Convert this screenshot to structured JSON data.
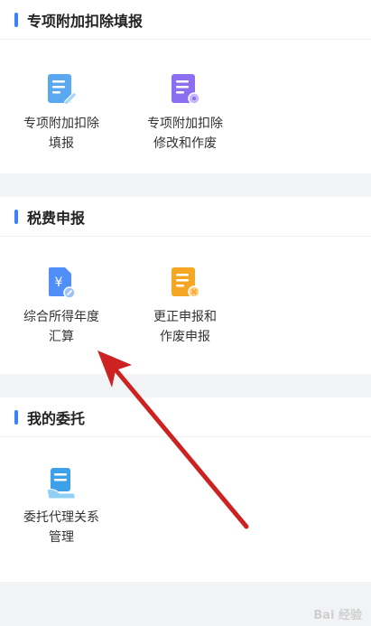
{
  "sections": [
    {
      "title": "专项附加扣除填报",
      "items": [
        {
          "line1": "专项附加扣除",
          "line2": "填报",
          "icon": "document-edit-icon",
          "color": "#5aa9f0"
        },
        {
          "line1": "专项附加扣除",
          "line2": "修改和作废",
          "icon": "document-settings-icon",
          "color": "#8b6ff0"
        }
      ]
    },
    {
      "title": "税费申报",
      "items": [
        {
          "line1": "综合所得年度",
          "line2": "汇算",
          "icon": "yuan-document-icon",
          "color": "#4f8ff7"
        },
        {
          "line1": "更正申报和",
          "line2": "作废申报",
          "icon": "document-cancel-icon",
          "color": "#f5a623"
        }
      ]
    },
    {
      "title": "我的委托",
      "items": [
        {
          "line1": "委托代理关系",
          "line2": "管理",
          "icon": "document-hand-icon",
          "color": "#3ea0e8"
        }
      ]
    }
  ],
  "watermark": "Bai 经验"
}
